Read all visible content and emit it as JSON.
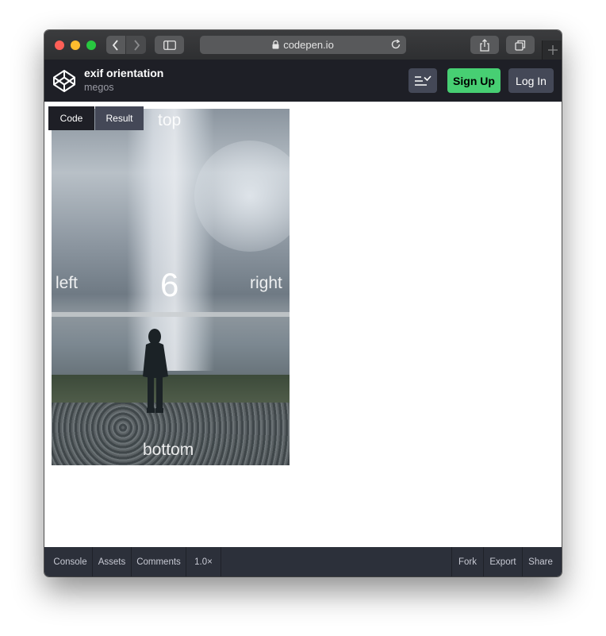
{
  "browser": {
    "url": "codepen.io"
  },
  "header": {
    "pen_title": "exif orientation",
    "pen_user": "megos",
    "signup_label": "Sign Up",
    "login_label": "Log In"
  },
  "result": {
    "tabs": {
      "code": "Code",
      "result": "Result"
    },
    "image_labels": {
      "top": "top",
      "left": "left",
      "right": "right",
      "bottom": "bottom",
      "orientation": "6"
    }
  },
  "footer": {
    "console": "Console",
    "assets": "Assets",
    "comments": "Comments",
    "zoom": "1.0×",
    "fork": "Fork",
    "export": "Export",
    "share": "Share"
  },
  "colors": {
    "signup_green": "#47cf73",
    "header_bg": "#1e1f26",
    "footer_bg": "#2c303a"
  },
  "icons": [
    "back-icon",
    "forward-icon",
    "sidebar-icon",
    "lock-icon",
    "reload-icon",
    "share-icon",
    "tabs-icon",
    "plus-icon",
    "codepen-logo-icon",
    "view-toggle-icon"
  ]
}
